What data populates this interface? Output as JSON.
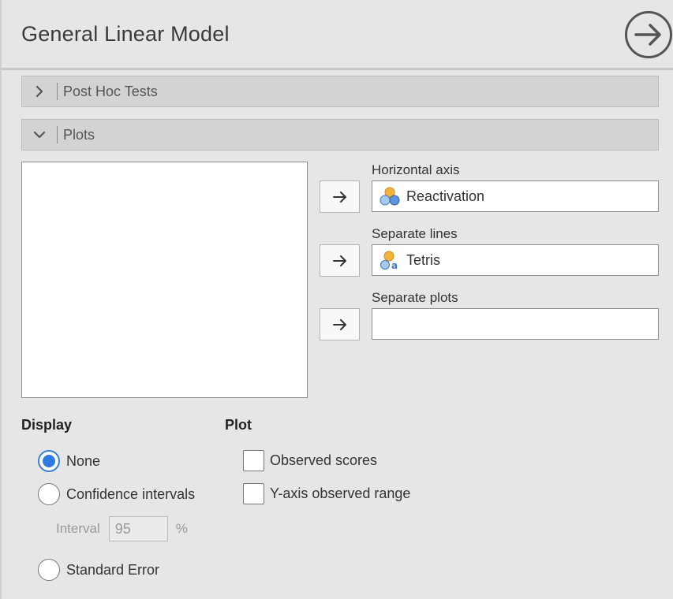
{
  "header": {
    "title": "General Linear Model",
    "run_icon": "arrow-right-circle-icon"
  },
  "sections": [
    {
      "label": "Post Hoc Tests",
      "expanded": false,
      "icon": "chevron-right-icon"
    },
    {
      "label": "Plots",
      "expanded": true,
      "icon": "chevron-down-icon"
    }
  ],
  "plots": {
    "available_variables": [],
    "targets": [
      {
        "label": "Horizontal axis",
        "variable": "Reactivation",
        "variable_icon": "nominal-variable-icon"
      },
      {
        "label": "Separate lines",
        "variable": "Tetris",
        "variable_icon": "nominal-text-variable-icon"
      },
      {
        "label": "Separate plots",
        "variable": ""
      }
    ],
    "transfer_icon": "arrow-right-icon",
    "display": {
      "heading": "Display",
      "options": [
        {
          "label": "None",
          "checked": true
        },
        {
          "label": "Confidence intervals",
          "checked": false
        },
        {
          "label": "Standard Error",
          "checked": false
        }
      ],
      "interval": {
        "label": "Interval",
        "value": "95",
        "unit": "%"
      }
    },
    "plot": {
      "heading": "Plot",
      "options": [
        {
          "label": "Observed scores",
          "checked": false
        },
        {
          "label": "Y-axis observed range",
          "checked": false
        }
      ]
    }
  },
  "colors": {
    "accent": "#2f7be0",
    "background": "#e6e6e6",
    "section_bar": "#d3d3d3"
  }
}
